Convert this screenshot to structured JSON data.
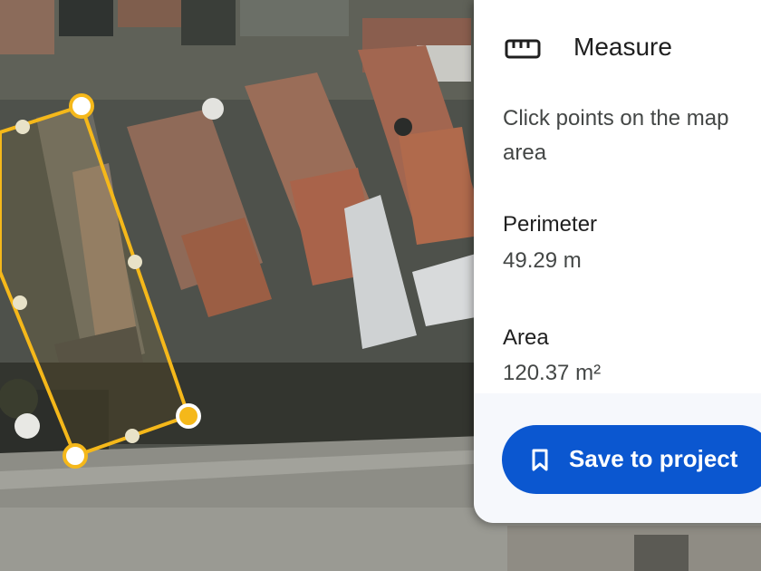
{
  "map": {
    "icons": [
      "drawn-rectangle-outline",
      "vertex-handle",
      "midpoint-handle"
    ],
    "colors": {
      "outline": "#f5b81a",
      "vertex_fill": "#ffffff",
      "active_vertex_fill": "#f5b81a"
    }
  },
  "panel": {
    "title": "Measure",
    "title_icon": "ruler-icon",
    "instruction": "Click points on the map",
    "instruction_line2": "area",
    "perimeter_label": "Perimeter",
    "perimeter_value": "49.29 m",
    "area_label": "Area",
    "area_value": "120.37 m²",
    "save_button_label": "Save to project",
    "save_icon": "bookmark-icon",
    "colors": {
      "button": "#0b57d0",
      "footer": "#f6f8fc"
    }
  }
}
